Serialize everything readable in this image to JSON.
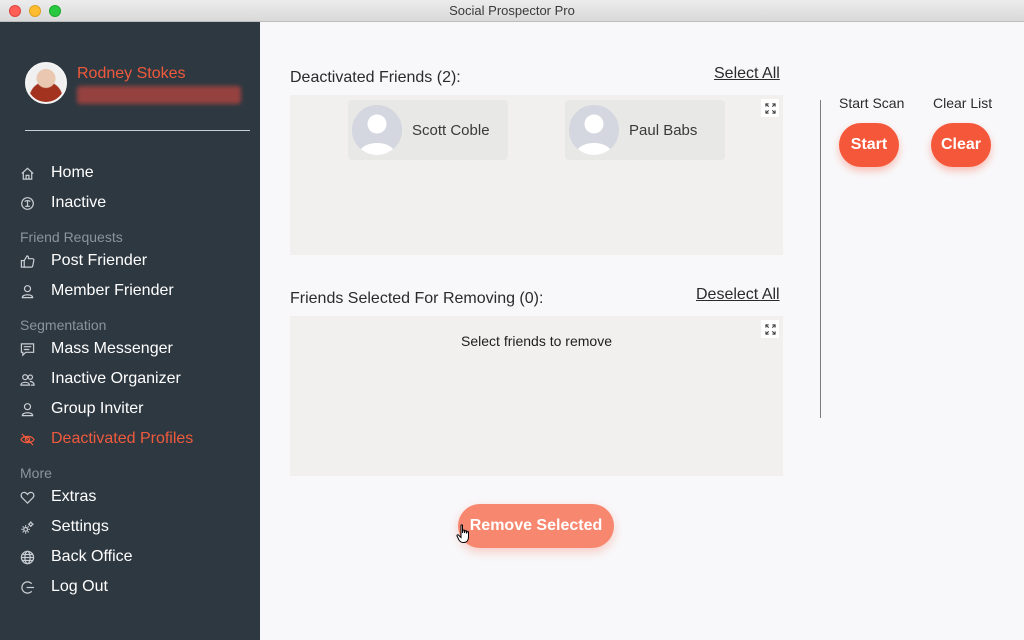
{
  "window": {
    "title": "Social Prospector Pro"
  },
  "profile": {
    "name": "Rodney Stokes"
  },
  "sidebar": {
    "items": [
      {
        "label": "Home",
        "icon": "home-icon"
      },
      {
        "label": "Inactive",
        "icon": "inactive-icon"
      },
      {
        "label": "Post Friender",
        "icon": "thumbs-up-icon"
      },
      {
        "label": "Member Friender",
        "icon": "user-icon"
      },
      {
        "label": "Mass Messenger",
        "icon": "message-icon"
      },
      {
        "label": "Inactive Organizer",
        "icon": "users-icon"
      },
      {
        "label": "Group Inviter",
        "icon": "user-icon"
      },
      {
        "label": "Deactivated Profiles",
        "icon": "eye-off-icon",
        "active": true
      },
      {
        "label": "Extras",
        "icon": "heart-icon"
      },
      {
        "label": "Settings",
        "icon": "gear-icon"
      },
      {
        "label": "Back Office",
        "icon": "globe-icon"
      },
      {
        "label": "Log Out",
        "icon": "logout-icon"
      }
    ],
    "sections": {
      "friend_requests": "Friend Requests",
      "segmentation": "Segmentation",
      "more": "More"
    }
  },
  "deactivated": {
    "title": "Deactivated Friends (2):",
    "select_all": "Select All",
    "friends": [
      {
        "name": "Scott Coble"
      },
      {
        "name": "Paul Babs"
      }
    ]
  },
  "selected": {
    "title": "Friends Selected For Removing (0):",
    "deselect_all": "Deselect All",
    "placeholder": "Select friends to remove"
  },
  "controls": {
    "start_scan_label": "Start Scan",
    "start_button": "Start",
    "clear_list_label": "Clear List",
    "clear_button": "Clear"
  },
  "actions": {
    "remove_selected": "Remove Selected"
  },
  "colors": {
    "accent": "#f5573a",
    "sidebar_bg": "#2e3841",
    "active_text": "#f05a3c"
  }
}
